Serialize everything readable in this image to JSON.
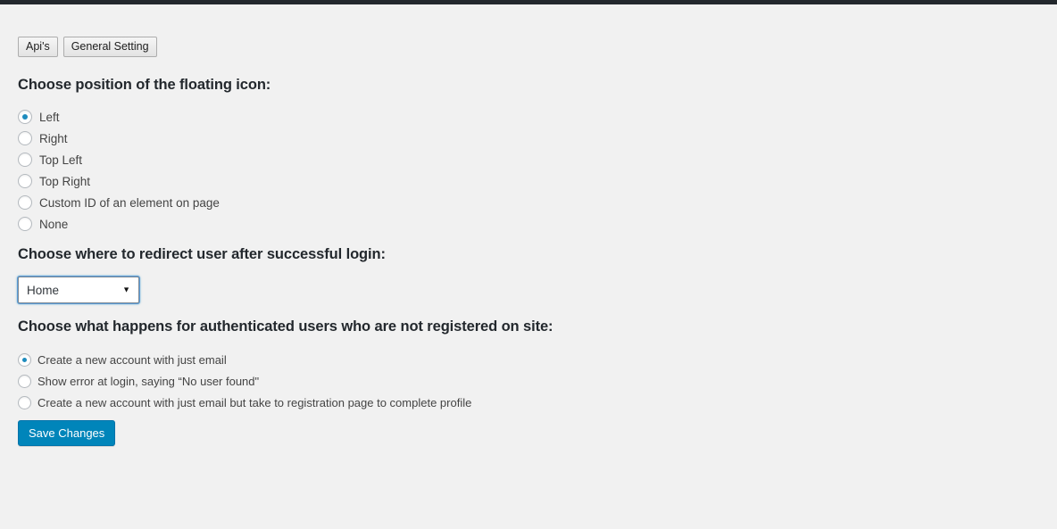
{
  "tabs": [
    {
      "label": "Api's"
    },
    {
      "label": "General Setting"
    }
  ],
  "sections": {
    "position": {
      "heading": "Choose position of the floating icon:",
      "options": [
        {
          "label": "Left",
          "checked": true
        },
        {
          "label": "Right",
          "checked": false
        },
        {
          "label": "Top Left",
          "checked": false
        },
        {
          "label": "Top Right",
          "checked": false
        },
        {
          "label": "Custom ID of an element on page",
          "checked": false
        },
        {
          "label": "None",
          "checked": false
        }
      ]
    },
    "redirect": {
      "heading": "Choose where to redirect user after successful login:",
      "selected": "Home",
      "arrow": "▼"
    },
    "unregistered": {
      "heading": "Choose what happens for authenticated users who are not registered on site:",
      "options": [
        {
          "label": "Create a new account with just email",
          "checked": true
        },
        {
          "label": "Show error at login, saying “No user found\"",
          "checked": false
        },
        {
          "label": "Create a new account with just email but take to registration page to complete profile",
          "checked": false
        }
      ]
    }
  },
  "submit": {
    "label": "Save Changes"
  },
  "colors": {
    "background": "#f1f1f1",
    "admin_bar": "#23282d",
    "heading_text": "#23282d",
    "body_text": "#444444",
    "accent_blue": "#1e8cbe",
    "button_blue": "#0085ba",
    "focus_blue": "#5b9dd9"
  }
}
